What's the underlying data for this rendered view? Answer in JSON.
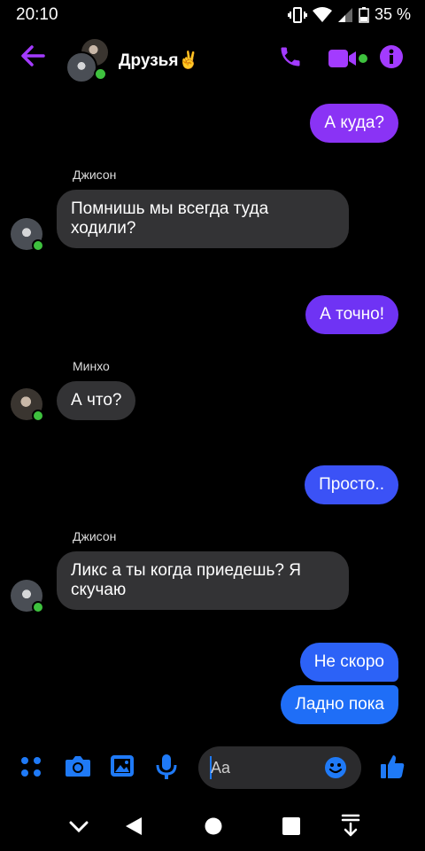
{
  "status_bar": {
    "time": "20:10",
    "battery": "35 %"
  },
  "header": {
    "title": "Друзья✌️",
    "icons": [
      "back-arrow-icon",
      "phone-icon",
      "video-call-icon",
      "info-icon"
    ]
  },
  "messages": [
    {
      "direction": "outgoing",
      "text": "А куда?"
    },
    {
      "direction": "incoming",
      "sender": "Джисон",
      "text1": "Помнишь мы всегда туда",
      "text2": "ходили?"
    },
    {
      "direction": "outgoing",
      "text": "А точно!"
    },
    {
      "direction": "incoming",
      "sender": "Минхо",
      "text": "А что?"
    },
    {
      "direction": "outgoing",
      "text": "Просто.."
    },
    {
      "direction": "incoming",
      "sender": "Джисон",
      "text1": "Ликс а ты когда приедешь? Я",
      "text2": "скучаю"
    },
    {
      "direction": "outgoing",
      "text": "Не скоро"
    },
    {
      "direction": "outgoing",
      "text": "Ладно пока"
    }
  ],
  "composer": {
    "placeholder": "Aa",
    "icons": [
      "apps-icon",
      "camera-icon",
      "gallery-icon",
      "microphone-icon",
      "emoji-icon",
      "like-icon"
    ]
  },
  "colors": {
    "accent": "#a33bff",
    "outgoing_top": "#8a33f5",
    "outgoing_bottom": "#1f6ef7",
    "incoming": "#333335",
    "online": "#3ec13e"
  }
}
